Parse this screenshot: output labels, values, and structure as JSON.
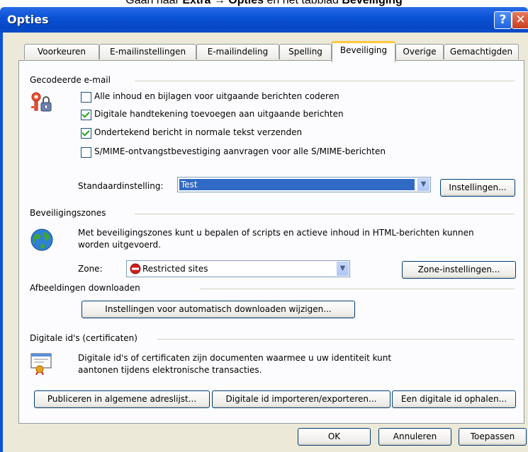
{
  "caption": {
    "prefix": "Gaan naar ",
    "menu": "Extra → Opties",
    "middle": " en het tabblad ",
    "tab": "Beveiliging"
  },
  "window": {
    "title": "Opties",
    "help": "?",
    "close": "✕"
  },
  "tabs": [
    "Voorkeuren",
    "E-mailinstellingen",
    "E-mailindeling",
    "Spelling",
    "Beveiliging",
    "Overige",
    "Gemachtigden"
  ],
  "encrypted": {
    "heading": "Gecodeerde e-mail",
    "options": [
      {
        "label": "Alle inhoud en bijlagen voor uitgaande berichten coderen",
        "checked": false
      },
      {
        "label": "Digitale handtekening toevoegen aan uitgaande berichten",
        "checked": true
      },
      {
        "label": "Ondertekend bericht in normale tekst verzenden",
        "checked": true
      },
      {
        "label": "S/MIME-ontvangstbevestiging aanvragen voor alle S/MIME-berichten",
        "checked": false
      }
    ],
    "default_label": "Standaardinstelling:",
    "default_value": "Test",
    "settings_button": "Instellingen..."
  },
  "zones": {
    "heading": "Beveiligingszones",
    "description": "Met beveiligingszones kunt u bepalen of scripts en actieve inhoud in HTML-berichten kunnen worden uitgevoerd.",
    "zone_label": "Zone:",
    "zone_value": "Restricted sites",
    "zone_button": "Zone-instellingen..."
  },
  "images": {
    "heading": "Afbeeldingen downloaden",
    "button": "Instellingen voor automatisch downloaden wijzigen..."
  },
  "digital_ids": {
    "heading": "Digitale id's (certificaten)",
    "description": "Digitale id's of certificaten zijn documenten waarmee u uw identiteit kunt aantonen tijdens elektronische transacties.",
    "publish_button": "Publiceren in algemene adreslijst...",
    "import_button": "Digitale id importeren/exporteren...",
    "get_button": "Een digitale id ophalen..."
  },
  "footer": {
    "ok": "OK",
    "cancel": "Annuleren",
    "apply": "Toepassen"
  }
}
